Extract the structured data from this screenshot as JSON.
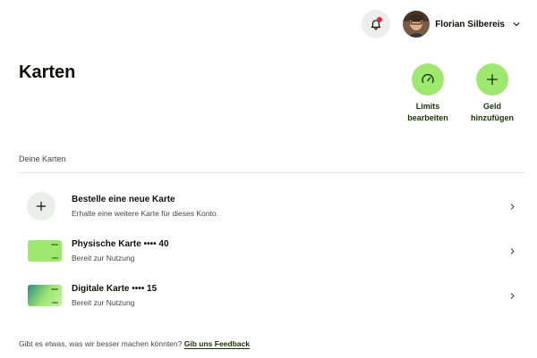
{
  "header": {
    "user_name": "Florian Silbereis",
    "notifications_icon": "bell-icon",
    "menu_icon": "chevron-down-icon"
  },
  "page": {
    "title": "Karten"
  },
  "actions": [
    {
      "label": "Limits\nbearbeiten",
      "icon": "speedometer-icon"
    },
    {
      "label": "Geld\nhinzufügen",
      "icon": "plus-icon"
    }
  ],
  "cards_section": {
    "label": "Deine Karten",
    "items": [
      {
        "title": "Bestelle eine neue Karte",
        "subtitle": "Erhalte eine weitere Karte für dieses Konto.",
        "icon": "plus-icon"
      },
      {
        "title": "Physische Karte •••• 40",
        "subtitle": "Bereit zur Nutzung",
        "icon": "physical-card-icon"
      },
      {
        "title": "Digitale Karte •••• 15",
        "subtitle": "Bereit zur Nutzung",
        "icon": "digital-card-icon"
      }
    ]
  },
  "feedback": {
    "text": "Gibt es etwas, was wir besser machen könnten?",
    "link": "Gib uns Feedback"
  },
  "colors": {
    "accent": "#9fe870",
    "accent_text": "#163300",
    "alert_dot": "#e0263f"
  }
}
